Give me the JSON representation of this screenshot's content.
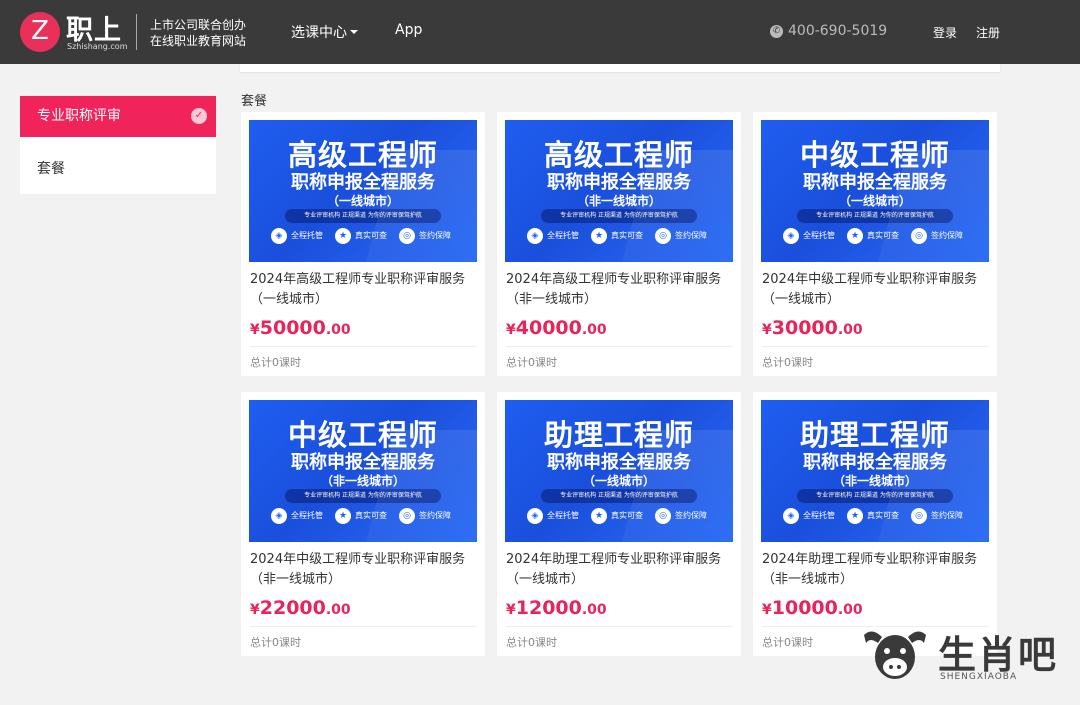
{
  "header": {
    "logo_mark": "Z",
    "logo_text": "职上",
    "logo_domain": "Szhishang.com",
    "slogan_line1": "上市公司联合创办",
    "slogan_line2": "在线职业教育网站",
    "nav_courses": "选课中心",
    "nav_app": "App",
    "phone": "400-690-5019",
    "login": "登录",
    "register": "注册"
  },
  "sidebar": {
    "items": [
      {
        "label": "专业职称评审",
        "active": true
      },
      {
        "label": "套餐",
        "active": false
      }
    ]
  },
  "section_title": "套餐",
  "banner_common": {
    "tagline": "专业评审机构 正规渠道 为你的评审保驾护航",
    "badges": [
      "全程托管",
      "真实可查",
      "签约保障"
    ]
  },
  "cards": [
    {
      "banner_l1": "高级工程师",
      "banner_l2": "职称申报全程服务",
      "banner_l3": "（一线城市）",
      "title": "2024年高级工程师专业职称评审服务（一线城市）",
      "price_symbol": "¥",
      "price_int": "50000",
      "price_dec": ".00",
      "hours": "总计0课时"
    },
    {
      "banner_l1": "高级工程师",
      "banner_l2": "职称申报全程服务",
      "banner_l3": "（非一线城市）",
      "title": "2024年高级工程师专业职称评审服务（非一线城市）",
      "price_symbol": "¥",
      "price_int": "40000",
      "price_dec": ".00",
      "hours": "总计0课时"
    },
    {
      "banner_l1": "中级工程师",
      "banner_l2": "职称申报全程服务",
      "banner_l3": "（一线城市）",
      "title": "2024年中级工程师专业职称评审服务（一线城市）",
      "price_symbol": "¥",
      "price_int": "30000",
      "price_dec": ".00",
      "hours": "总计0课时"
    },
    {
      "banner_l1": "中级工程师",
      "banner_l2": "职称申报全程服务",
      "banner_l3": "（非一线城市）",
      "title": "2024年中级工程师专业职称评审服务（非一线城市）",
      "price_symbol": "¥",
      "price_int": "22000",
      "price_dec": ".00",
      "hours": "总计0课时"
    },
    {
      "banner_l1": "助理工程师",
      "banner_l2": "职称申报全程服务",
      "banner_l3": "（一线城市）",
      "title": "2024年助理工程师专业职称评审服务（一线城市）",
      "price_symbol": "¥",
      "price_int": "12000",
      "price_dec": ".00",
      "hours": "总计0课时"
    },
    {
      "banner_l1": "助理工程师",
      "banner_l2": "职称申报全程服务",
      "banner_l3": "（非一线城市）",
      "title": "2024年助理工程师专业职称评审服务（非一线城市）",
      "price_symbol": "¥",
      "price_int": "10000",
      "price_dec": ".00",
      "hours": "总计0课时"
    }
  ],
  "watermark": {
    "text": "生肖吧",
    "sub": "SHENGXIAOBA"
  },
  "colors": {
    "header_bg": "#3a3a3a",
    "accent": "#f0245a",
    "banner_blue": "#1f5ef0"
  },
  "icons": {
    "phone": "phone-icon",
    "check": "check-icon",
    "caret": "chevron-down-icon"
  }
}
